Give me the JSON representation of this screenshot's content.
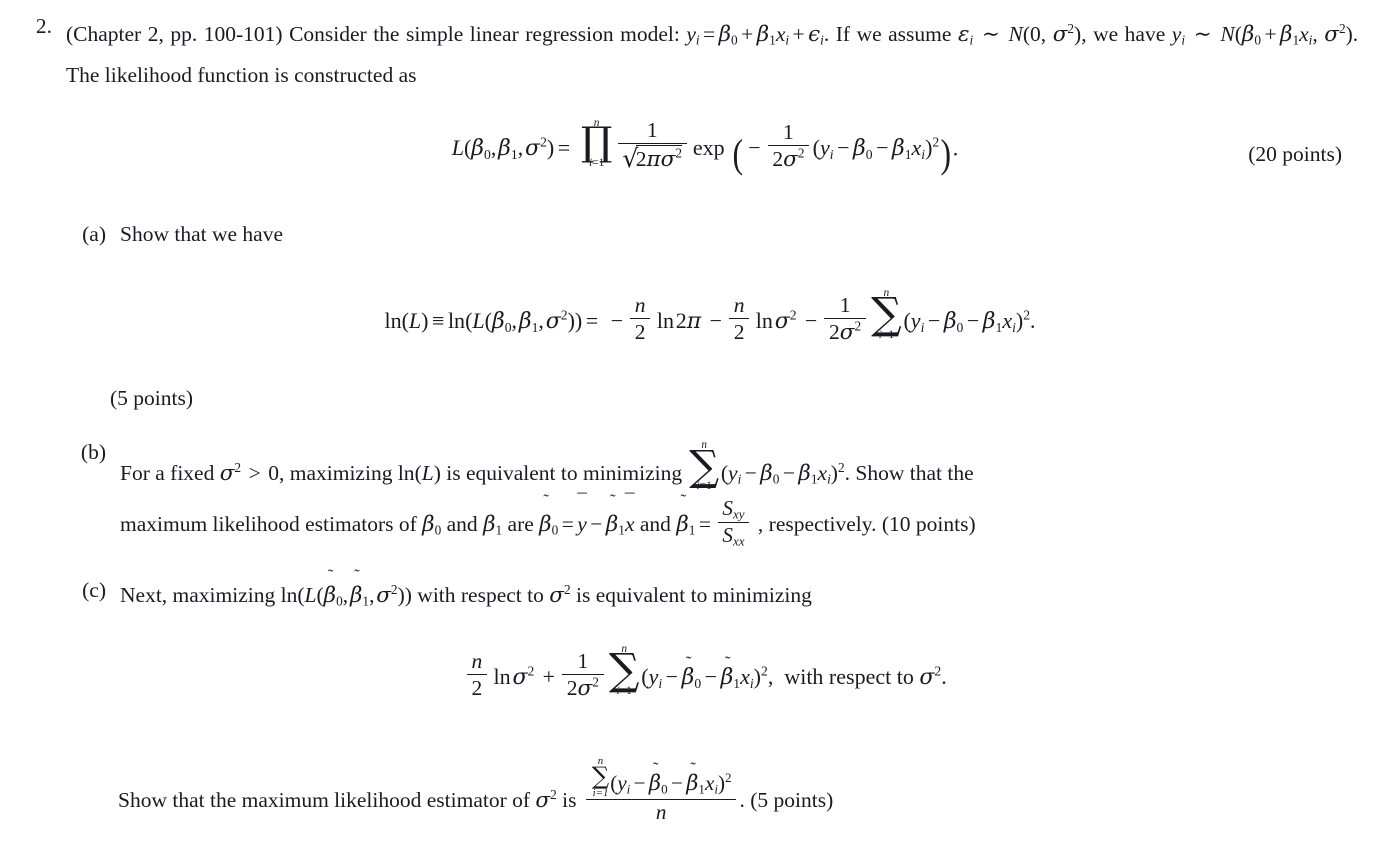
{
  "document": {
    "type": "homework-problem",
    "problem_number": "2.",
    "intro": {
      "ref": "(Chapter 2, pp.  100-101)",
      "text_1": "Consider the simple linear regression model:",
      "model_eq": "y_i = β_0 + β_1 x_i + ϵ_i.",
      "text_2": "If we assume",
      "assume_eq": "ε_i ~ N(0, σ²),",
      "text_3": "we have",
      "dist_eq": "y_i ~ N(β_0 + β_1 x_i, σ²).",
      "text_4": "The likelihood function is constructed as",
      "points": "(20 points)"
    },
    "likelihood_display": {
      "lhs": "L(β_0, β_1, σ²) =",
      "product_upper": "n",
      "product_lower": "i=1",
      "fraction_numerator": "1",
      "fraction_denominator": "√(2πσ²)",
      "exp_label": "exp",
      "exp_frac_numerator": "1",
      "exp_frac_denominator": "2σ²",
      "exp_body": "(y_i − β_0 − β_1 x_i)²",
      "trailing": "."
    },
    "parts": [
      {
        "label": "(a)",
        "text": "Show that we have",
        "points": "(5 points)",
        "display": {
          "lhs": "ln(L) ≡ ln(L(β_0, β_1, σ²)) =",
          "term_1_sign": "−",
          "term_1_frac_num": "n",
          "term_1_frac_den": "2",
          "term_1_body": "ln 2π",
          "term_2_sign": "−",
          "term_2_frac_num": "n",
          "term_2_frac_den": "2",
          "term_2_body": "ln σ²",
          "term_3_sign": "−",
          "term_3_frac_num": "1",
          "term_3_frac_den": "2σ²",
          "sum_upper": "n",
          "sum_lower": "i=1",
          "sum_body": "(y_i − β_0 − β_1 x_i)²",
          "trailing": "."
        }
      },
      {
        "label": "(b)",
        "text_1": "For a fixed",
        "cond": "σ² > 0,",
        "text_2": "maximizing",
        "lnL": "ln(L)",
        "text_3": "is equivalent to minimizing",
        "sum_upper": "n",
        "sum_lower": "i=1",
        "sum_body": "(y_i − β_0 − β_1 x_i)².",
        "text_4": "Show that the",
        "text_5": "maximum likelihood estimators of",
        "beta0": "β_0",
        "text_6": "and",
        "beta1": "β_1",
        "text_7": "are",
        "est0": "β̃0 = ȳ − β̃1 x̄",
        "text_8": "and",
        "est1_lhs": "β̃1 =",
        "est1_num": "S_xy",
        "est1_den": "S_xx",
        "text_9": ", respectively.",
        "points": "(10 points)"
      },
      {
        "label": "(c)",
        "text_1": "Next, maximizing",
        "expr": "ln(L(β̃0, β̃1, σ²))",
        "text_2": "with respect to",
        "sigma2": "σ²",
        "text_3": "is equivalent to minimizing",
        "display": {
          "frac1_num": "n",
          "frac1_den": "2",
          "ln_sigma": "ln σ²",
          "plus": "+",
          "frac2_num": "1",
          "frac2_den": "2σ²",
          "sum_upper": "n",
          "sum_lower": "i=1",
          "sum_body": "(y_i − β̃0 − β̃1 x_i)²,",
          "tail": "with respect to σ²."
        },
        "final": {
          "text_1": "Show that the maximum likelihood estimator of",
          "sigma2": "σ²",
          "text_2": "is",
          "frac_num": "∑ⁿᵢ₌₁ (y_i − β̃0 − β̃1 x_i)²",
          "frac_den": "n",
          "text_3": ".",
          "points": "(5 points)"
        }
      }
    ],
    "glyphs": {
      "product": "∏",
      "sum": "∑",
      "radical": "√",
      "identical": "≡",
      "sim": "∼",
      "minus": "−",
      "plus": "+",
      "equals": "=",
      "gt": ">",
      "tilde": "˜",
      "macron": "¯",
      "lparen_big": "(",
      "rparen_big": ")"
    }
  }
}
